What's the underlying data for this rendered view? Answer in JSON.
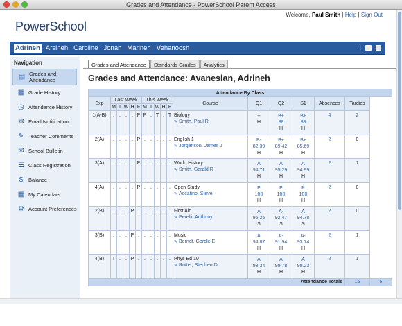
{
  "window": {
    "title": "Grades and Attendance - PowerSchool Parent Access"
  },
  "header": {
    "welcome_prefix": "Welcome,",
    "user_name": "Paul Smith",
    "sep1": "|",
    "help": "Help",
    "sep2": "|",
    "sign_out": "Sign Out",
    "logo": "PowerSchool"
  },
  "students": [
    "Adrineh",
    "Arsineh",
    "Caroline",
    "Jonah",
    "Marineh",
    "Vehanoosh"
  ],
  "navbar_icons": {
    "alert": "!",
    "print": "printer-icon"
  },
  "sidebar": {
    "title": "Navigation",
    "items": [
      {
        "label": "Grades and Attendance",
        "icon": "grades-icon"
      },
      {
        "label": "Grade History",
        "icon": "history-icon"
      },
      {
        "label": "Attendance History",
        "icon": "clock-icon"
      },
      {
        "label": "Email Notification",
        "icon": "email-icon"
      },
      {
        "label": "Teacher Comments",
        "icon": "comments-icon"
      },
      {
        "label": "School Bulletin",
        "icon": "bulletin-icon"
      },
      {
        "label": "Class Registration",
        "icon": "registration-icon"
      },
      {
        "label": "Balance",
        "icon": "balance-icon"
      },
      {
        "label": "My Calendars",
        "icon": "calendar-icon"
      },
      {
        "label": "Account Preferences",
        "icon": "preferences-icon"
      }
    ]
  },
  "tabs": [
    "Grades and Attendance",
    "Standards Grades",
    "Analytics"
  ],
  "page_title": "Grades and Attendance: Avanesian, Adrineh",
  "table": {
    "caption": "Attendance By Class",
    "headers": {
      "exp": "Exp",
      "last_week": "Last Week",
      "this_week": "This Week",
      "course": "Course",
      "q1": "Q1",
      "q2": "Q2",
      "s1": "S1",
      "absences": "Absences",
      "tardies": "Tardies"
    },
    "days": [
      "M",
      "T",
      "W",
      "H",
      "F",
      "M",
      "T",
      "W",
      "H",
      "F"
    ],
    "rows": [
      {
        "exp": "1(A-B)",
        "att": [
          ".",
          ".",
          ".",
          ".",
          "P",
          "P",
          ".",
          "T",
          ".",
          "T"
        ],
        "course": "Biology",
        "teacher": "Smith, Paul R",
        "q1": [
          "--",
          "H"
        ],
        "q2": [
          "B+",
          "88",
          "H"
        ],
        "s1": [
          "B+",
          "88",
          "H"
        ],
        "absences": "4",
        "tardies": "2"
      },
      {
        "exp": "2(A)",
        "att": [
          ".",
          ".",
          ".",
          ".",
          "P",
          ".",
          ".",
          ".",
          ".",
          "."
        ],
        "course": "English 1",
        "teacher": "Jorgenson, James J",
        "q1": [
          "B-",
          "82.39",
          "H"
        ],
        "q2": [
          "B+",
          "89.42",
          "H"
        ],
        "s1": [
          "B+",
          "85.69",
          "H"
        ],
        "absences": "2",
        "tardies": "0"
      },
      {
        "exp": "3(A)",
        "att": [
          ".",
          ".",
          ".",
          ".",
          "P",
          ".",
          ".",
          ".",
          ".",
          "."
        ],
        "course": "World History",
        "teacher": "Smith, Gerald R",
        "q1": [
          "A",
          "94.71",
          "H"
        ],
        "q2": [
          "A",
          "95.29",
          "H"
        ],
        "s1": [
          "A",
          "94.99",
          "H"
        ],
        "absences": "2",
        "tardies": "1"
      },
      {
        "exp": "4(A)",
        "att": [
          ".",
          ".",
          ".",
          ".",
          "P",
          ".",
          ".",
          ".",
          ".",
          "."
        ],
        "course": "Open Study",
        "teacher": "Accatino, Steve",
        "q1": [
          "P",
          "100",
          "H"
        ],
        "q2": [
          "P",
          "100",
          "H"
        ],
        "s1": [
          "P",
          "100",
          "H"
        ],
        "absences": "2",
        "tardies": "0"
      },
      {
        "exp": "2(B)",
        "att": [
          ".",
          ".",
          ".",
          "P",
          ".",
          ".",
          ".",
          ".",
          ".",
          "."
        ],
        "course": "First Aid",
        "teacher": "Perelli, Anthony",
        "q1": [
          "A",
          "95.25",
          "S"
        ],
        "q2": [
          "A-",
          "92.47",
          "S"
        ],
        "s1": [
          "A",
          "94.78",
          "S"
        ],
        "absences": "2",
        "tardies": "0"
      },
      {
        "exp": "3(B)",
        "att": [
          ".",
          ".",
          ".",
          "P",
          ".",
          ".",
          ".",
          ".",
          ".",
          "."
        ],
        "course": "Music",
        "teacher": "Berndt, Gordie E",
        "q1": [
          "A",
          "94.87",
          "H"
        ],
        "q2": [
          "A-",
          "91.94",
          "H"
        ],
        "s1": [
          "A-",
          "93.74",
          "H"
        ],
        "absences": "2",
        "tardies": "1"
      },
      {
        "exp": "4(B)",
        "att": [
          "T",
          ".",
          ".",
          "P",
          ".",
          ".",
          ".",
          ".",
          ".",
          "."
        ],
        "course": "Phys Ed 10",
        "teacher": "Rutter, Stephen D",
        "q1": [
          "A",
          "98.34",
          "H"
        ],
        "q2": [
          "A",
          "99.78",
          "H"
        ],
        "s1": [
          "A",
          "99.23",
          "H"
        ],
        "absences": "2",
        "tardies": "1"
      }
    ],
    "totals": {
      "label": "Attendance Totals",
      "absences": "16",
      "tardies": "5"
    }
  },
  "colors": {
    "navbar": "#2a5b9f",
    "link": "#2f63a3",
    "caption": "#c3d5ec",
    "sidebar": "#eaf0f7"
  }
}
